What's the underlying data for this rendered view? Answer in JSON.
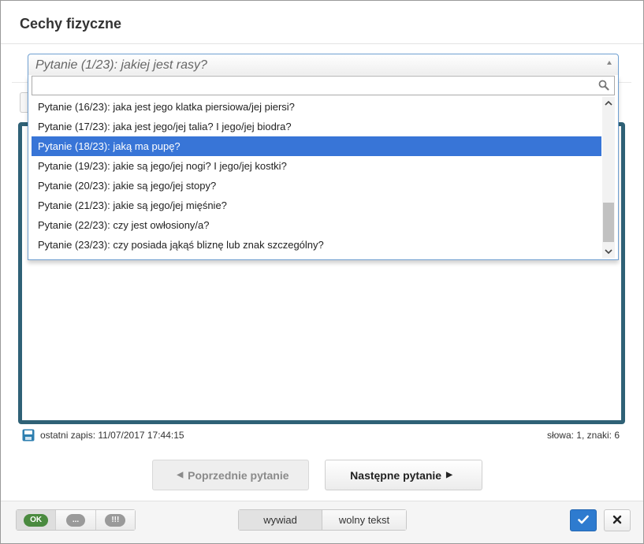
{
  "dialog": {
    "title": "Cechy fizyczne"
  },
  "question_select": {
    "selected": "Pytanie (1/23): jakiej jest rasy?",
    "search_value": "",
    "options": [
      "Pytanie (16/23): jaka jest jego klatka piersiowa/jej piersi?",
      "Pytanie (17/23): jaka jest jego/jej talia? I jego/jej biodra?",
      "Pytanie (18/23): jaką ma pupę?",
      "Pytanie (19/23): jakie są jego/jej nogi? I jego/jej kostki?",
      "Pytanie (20/23): jakie są jego/jej stopy?",
      "Pytanie (21/23): jakie są jego/jej mięśnie?",
      "Pytanie (22/23): czy jest owłosiony/a?",
      "Pytanie (23/23): czy posiada jąkąś bliznę lub znak szczególny?"
    ],
    "highlighted_index": 2
  },
  "status": {
    "last_save_label": "ostatni zapis: 11/07/2017 17:44:15",
    "counts": "słowa: 1, znaki: 6"
  },
  "navigation": {
    "prev_label": "Poprzednie pytanie",
    "next_label": "Następne pytanie"
  },
  "footer": {
    "status_buttons": [
      "OK",
      "...",
      "!!!"
    ],
    "modes": [
      "wywiad",
      "wolny tekst"
    ],
    "active_mode": "wywiad"
  },
  "colors": {
    "accent": "#2e7bcf",
    "highlight": "#3875d7",
    "editor_border": "#2f6176",
    "ok_green": "#4a8a3f"
  },
  "icons": {
    "search": "search-icon",
    "save": "floppy-disk-icon",
    "confirm": "checkmark-icon",
    "close": "close-icon"
  }
}
